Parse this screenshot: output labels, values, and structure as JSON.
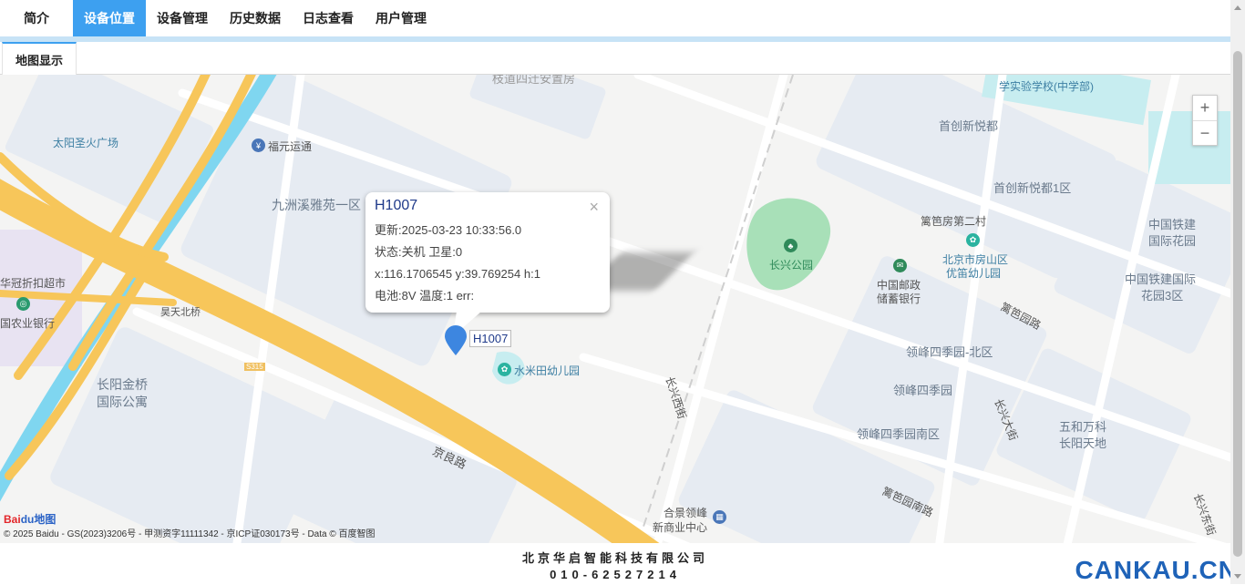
{
  "nav": {
    "items": [
      "简介",
      "设备位置",
      "设备管理",
      "历史数据",
      "日志查看",
      "用户管理"
    ],
    "active": "设备位置"
  },
  "subtab": "地图显示",
  "map": {
    "labels": {
      "taiyang": "太阳圣火广场",
      "fuyuan": "福元运通",
      "jiuzhou": "九洲溪雅苑一区",
      "huaguan": "华冠折扣超市",
      "nongye": "国农业银行",
      "haotian": "昊天北桥",
      "changyang": "长阳金桥",
      "changyang2": "国际公寓",
      "jingliang": "京良路",
      "s315": "S315",
      "shuimitian": "水米田幼儿园",
      "xuexiao": "学实验学校(中学部)",
      "shouchuang": "首创新悦都",
      "shouchuang1": "首创新悦都1区",
      "lianbei": "篱笆房第二村",
      "changxing_park": "长兴公园",
      "youzheng1": "中国邮政",
      "youzheng2": "储蓄银行",
      "youer1": "北京市房山区",
      "youer2": "优笛幼儿园",
      "tiejian1": "中国铁建",
      "tiejian2": "国际花园",
      "tiejian3": "中国铁建国际",
      "tiejian4": "花园3区",
      "libayuan": "篱笆园路",
      "lingfeng_n": "领峰四季园-北区",
      "lingfeng": "领峰四季园",
      "lingfeng_s": "领峰四季园南区",
      "wuhe1": "五和万科",
      "wuhe2": "长阳天地",
      "changxing_dajie": "长兴大街",
      "changxing_xijie": "长兴西街",
      "libayuan_nan": "篱笆园南路",
      "hejing1": "合景领峰",
      "hejing2": "新商业中心",
      "changxing_dong": "长兴东街",
      "top_cut": "枝道四迁安置房"
    },
    "zoom_in": "+",
    "zoom_out": "−",
    "logo_a": "Bai",
    "logo_b": "du地图",
    "copyright": "© 2025 Baidu - GS(2023)3206号 - 甲测资字11111342 - 京ICP证030173号 - Data © 百度智图"
  },
  "popup": {
    "title": "H1007",
    "line1": "更新:2025-03-23 10:33:56.0",
    "line2": "状态:关机 卫星:0",
    "line3": "x:116.1706545 y:39.769254 h:1",
    "line4": "电池:8V 温度:1 err:",
    "close": "×"
  },
  "marker_label": "H1007",
  "footer": {
    "company": "北京华启智能科技有限公司",
    "phone": "010-62527214"
  },
  "watermark": "CANKAU.CN",
  "colors": {
    "accent": "#3da0f0",
    "highway": "#f7c65a",
    "river": "#7fd6f0",
    "park": "#a8e0b8",
    "block": "#e6ebf2"
  }
}
